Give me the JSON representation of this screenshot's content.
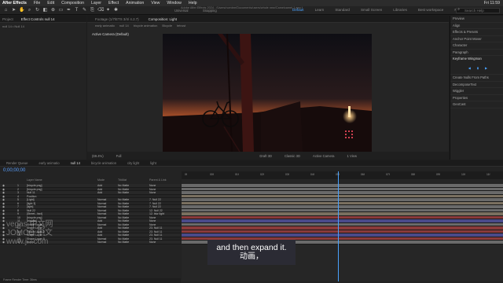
{
  "menubar": {
    "items": [
      "After Effects",
      "File",
      "Edit",
      "Composition",
      "Layer",
      "Effect",
      "Animation",
      "View",
      "Window",
      "Help"
    ],
    "clock": "Fri 11:59"
  },
  "toolbar": {
    "doc_title": "Adobe After Effects 2024 - /Users/nombre/Documents/users/whole new/Camelcamel-1.aep *",
    "snapping": "Snapping",
    "universal": "Universal",
    "workspaces": [
      "Default",
      "Learn",
      "Standard",
      "Small Screen",
      "Libraries",
      "Best workspace",
      "Review"
    ],
    "search_placeholder": "Search Help"
  },
  "project_panel": {
    "tabs": [
      "Project",
      "Effect Controls null 14"
    ],
    "subtitle": "null 14 • Null 14"
  },
  "comp_panel": {
    "tabs": [
      "Footage (1/7/ETS 3/4/ 4.2.7)",
      "Composition: Light"
    ],
    "crumbs": [
      "early animatio",
      "null 14",
      "bicycle animation",
      "Bicycle",
      "tetrust"
    ],
    "camera_label": "Active Camera (Default)",
    "bottom": [
      "(69.4%)",
      "Full",
      "Draft 3D",
      "Classic 3D",
      "Active Camera",
      "1 View"
    ]
  },
  "right_panel": {
    "items": [
      "Preview",
      "Align",
      "Effects & Presets",
      "Anchor Point Mover",
      "Character",
      "Paragraph",
      "Keyframe Wingman",
      "Create Nulls From Paths",
      "DecomposeText",
      "Wiggler",
      "Properties",
      "GeoCast"
    ]
  },
  "timeline": {
    "tabs": [
      "Render Queue",
      "early animatio",
      "null 14",
      "bicycle animation",
      "city light",
      "light"
    ],
    "timecode": "0;00;00;00",
    "columns": [
      "Layer Name",
      "Mode",
      "TrkMat",
      "Parent & Link"
    ],
    "layers": [
      {
        "num": "1",
        "name": "[bicycle.png]",
        "mode": "Add",
        "trk": "No Matte",
        "parent": "None"
      },
      {
        "num": "2",
        "name": "[bicycle.png]",
        "mode": "Add",
        "trk": "No Matte",
        "parent": "None"
      },
      {
        "num": "3",
        "name": "Null 11",
        "mode": "Add",
        "trk": "No Matte",
        "parent": "None"
      },
      {
        "num": "4",
        "name": "Position",
        "mode": "",
        "trk": "",
        "parent": ""
      },
      {
        "num": "5",
        "name": "[Light]",
        "mode": "Normal",
        "trk": "No Matte",
        "parent": "7. Null 22"
      },
      {
        "num": "6",
        "name": "[light 3]",
        "mode": "Normal",
        "trk": "No Matte",
        "parent": "7. Null 22"
      },
      {
        "num": "7",
        "name": "[light]",
        "mode": "Normal",
        "trk": "No Matte",
        "parent": "7. Null 22"
      },
      {
        "num": "8",
        "name": "Null 22",
        "mode": "Normal",
        "trk": "No Matte",
        "parent": "12. Null 22"
      },
      {
        "num": "9",
        "name": "[Street...fact]",
        "mode": "Normal",
        "trk": "No Matte",
        "parent": "12. blur light"
      },
      {
        "num": "10",
        "name": "[bicycle.png]",
        "mode": "Normal",
        "trk": "No Matte",
        "parent": "None"
      },
      {
        "num": "11",
        "name": "[bicycle]",
        "mode": "Add",
        "trk": "No Matte",
        "parent": "None"
      },
      {
        "num": "12",
        "name": "Shape Layer 1",
        "mode": "Normal",
        "trk": "No Matte",
        "parent": "None"
      },
      {
        "num": "13",
        "name": "Shape Layer 2",
        "mode": "Add",
        "trk": "No Matte",
        "parent": "23. Null 11"
      },
      {
        "num": "14",
        "name": "Shape Layer 3",
        "mode": "Add",
        "trk": "No Matte",
        "parent": "23. Null 11"
      },
      {
        "num": "15",
        "name": "Shape Layer 4",
        "mode": "Add",
        "trk": "No Matte",
        "parent": "23. Null 11"
      },
      {
        "num": "16",
        "name": "Shape Layer 5",
        "mode": "Normal",
        "trk": "No Matte",
        "parent": "23. Null 11"
      },
      {
        "num": "17",
        "name": "Bulbs",
        "mode": "Normal",
        "trk": "No Matte",
        "parent": "None"
      }
    ],
    "ruler_ticks": [
      "0f",
      "00f",
      "01f",
      "02f",
      "03f",
      "04f",
      "05f",
      "06f",
      "07f",
      "08f",
      "09f",
      "10f",
      "11f"
    ],
    "status": "Frame Render Time: 36ms"
  },
  "subtitle": {
    "english": "and then expand it.",
    "chinese": "动画，"
  },
  "watermark": {
    "lines": [
      "vegas 中文网",
      "JOMCO 中文",
      "www.j...com"
    ]
  },
  "colors": {
    "accent": "#4aa3ff",
    "bar_red": "#8a3a3a",
    "bar_blue": "#4a4a8a",
    "bar_gray": "#6a6a6a",
    "bar_tan": "#7a7060"
  }
}
